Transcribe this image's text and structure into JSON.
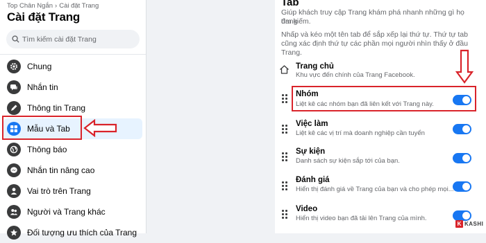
{
  "sidebar": {
    "breadcrumb": {
      "parent": "Top Chân Ngắn",
      "separator": "›",
      "current": "Cài đặt Trang"
    },
    "title": "Cài đặt Trang",
    "search_placeholder": "Tìm kiếm cài đặt Trang",
    "items": [
      {
        "label": "Chung",
        "icon": "gear-icon"
      },
      {
        "label": "Nhắn tin",
        "icon": "chat-icon"
      },
      {
        "label": "Thông tin Trang",
        "icon": "pencil-icon"
      },
      {
        "label": "Mẫu và Tab",
        "icon": "grid-icon",
        "active": true
      },
      {
        "label": "Thông báo",
        "icon": "globe-icon"
      },
      {
        "label": "Nhắn tin nâng cao",
        "icon": "messenger-icon"
      },
      {
        "label": "Vai trò trên Trang",
        "icon": "person-icon"
      },
      {
        "label": "Người và Trang khác",
        "icon": "people-icon"
      },
      {
        "label": "Đối tượng ưu thích của Trang",
        "icon": "star-icon"
      }
    ]
  },
  "content": {
    "title": "Tab",
    "desc1_line1": "Giúp khách truy cập Trang khám phá nhanh những gì họ đang",
    "desc1_line2": "tìm kiếm.",
    "desc2_line1": "Nhấp và kéo một tên tab để sắp xếp lại thứ tự. Thứ tự tab",
    "desc2_line2": "cũng xác định thứ tự các phần mọi người nhìn thấy ở đầu",
    "desc2_line3": "Trang.",
    "tabs": [
      {
        "title": "Trang chủ",
        "subtitle": "Khu vực đến chính của Trang Facebook."
      },
      {
        "title": "Nhóm",
        "subtitle": "Liệt kê các nhóm bạn đã liên kết với Trang này.",
        "enabled": true
      },
      {
        "title": "Việc làm",
        "subtitle": "Liệt kê các vị trí mà doanh nghiệp cần tuyển",
        "enabled": true
      },
      {
        "title": "Sự kiện",
        "subtitle": "Danh sách sự kiện sắp tới của bạn.",
        "enabled": true
      },
      {
        "title": "Đánh giá",
        "subtitle": "Hiển thị đánh giá về Trang của bạn và cho phép mọi...",
        "enabled": true
      },
      {
        "title": "Video",
        "subtitle": "Hiển thị video bạn đã tải lên Trang của mình.",
        "enabled": true
      }
    ]
  },
  "watermark": {
    "badge": "K",
    "text": "KASHI"
  },
  "colors": {
    "accent": "#1877f2",
    "highlight": "#d9232a",
    "active_bg": "#e7f3ff"
  }
}
